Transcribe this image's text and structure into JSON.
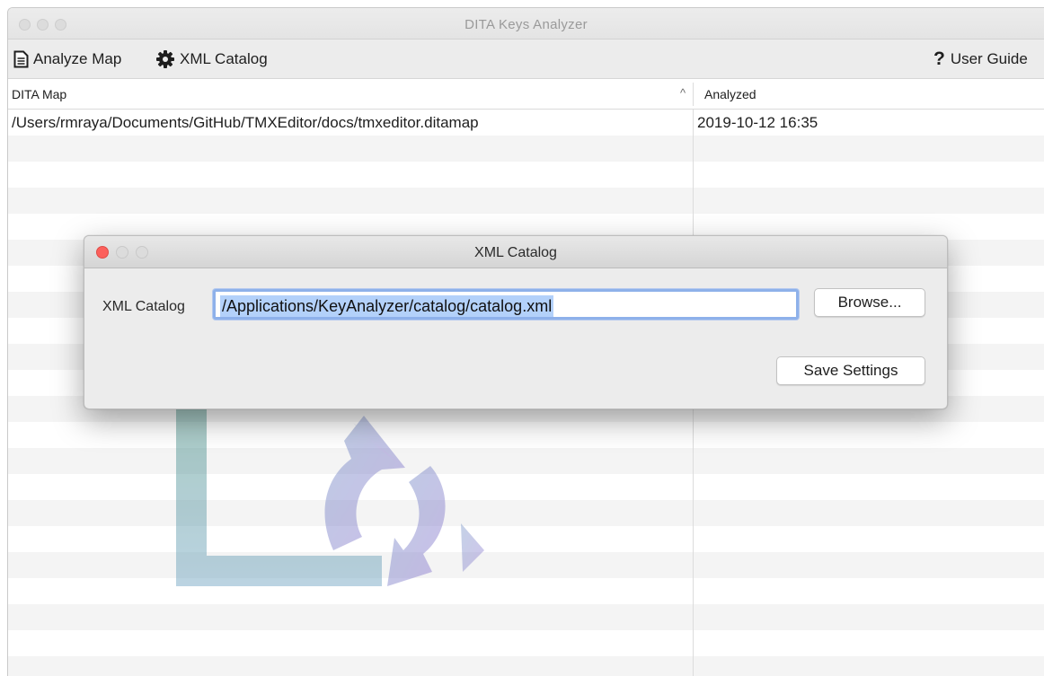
{
  "window": {
    "title": "DITA Keys Analyzer"
  },
  "toolbar": {
    "analyze_label": "Analyze Map",
    "catalog_label": "XML Catalog",
    "guide_label": "User Guide"
  },
  "table": {
    "columns": [
      "DITA Map",
      "Analyzed"
    ],
    "sorted_column": "DITA Map",
    "sort_direction": "ascending",
    "rows": [
      {
        "map": "/Users/rmraya/Documents/GitHub/TMXEditor/docs/tmxeditor.ditamap",
        "analyzed": "2019-10-12 16:35"
      }
    ]
  },
  "dialog": {
    "title": "XML Catalog",
    "field_label": "XML Catalog",
    "field_value": "/Applications/KeyAnalyzer/catalog/catalog.xml",
    "browse_label": "Browse...",
    "save_label": "Save Settings"
  },
  "colors": {
    "close_dot": "#fc605c",
    "inactive_dot": "#dcdcdc",
    "focus_ring": "#8eb1ea",
    "selection": "#b3d1fa"
  }
}
